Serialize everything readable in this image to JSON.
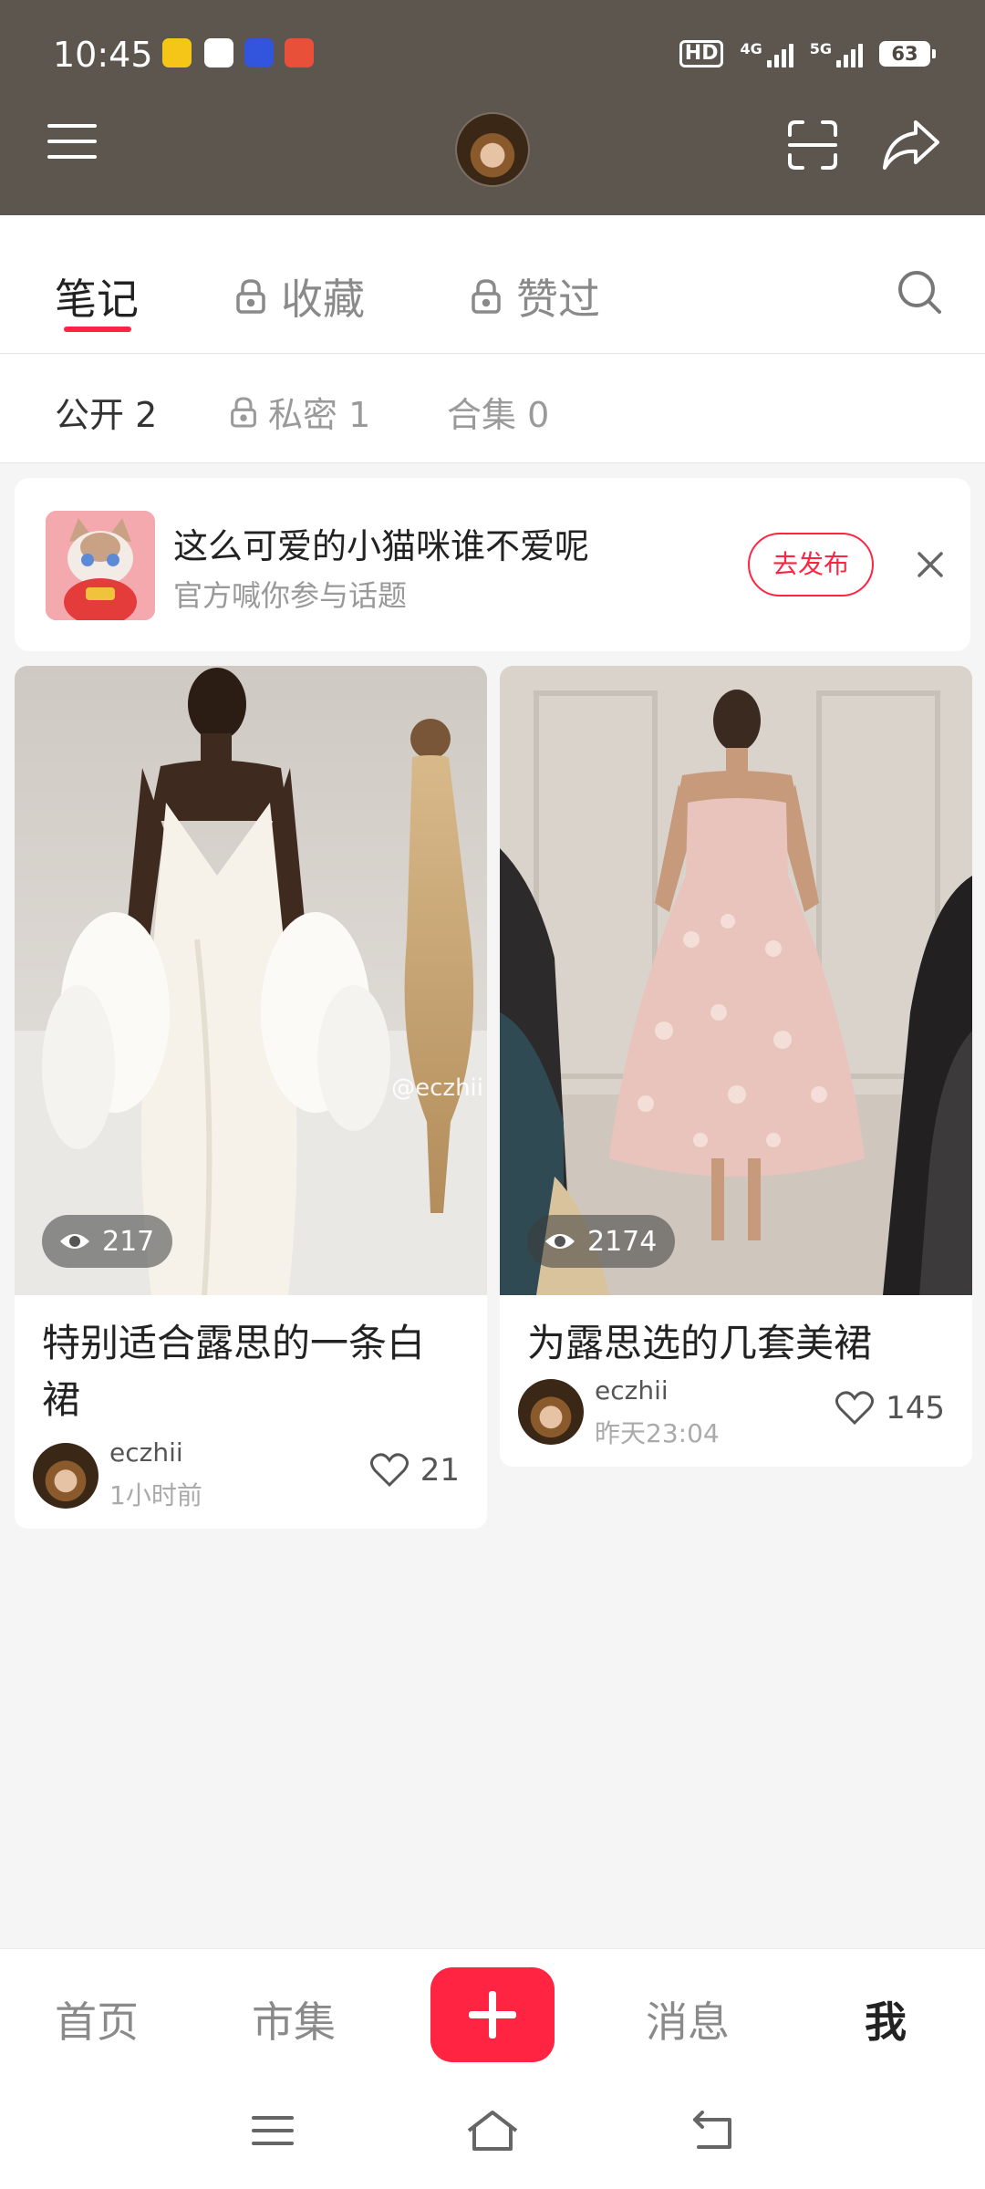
{
  "status_bar": {
    "time": "10:45",
    "app_icons": [
      {
        "name": "weibo-app-icon",
        "color": "#f5c518"
      },
      {
        "name": "wallet-app-icon",
        "color": "#ffffff"
      },
      {
        "name": "blue-app-icon",
        "color": "#3355dd"
      },
      {
        "name": "red-app-icon",
        "color": "#e8503a"
      }
    ],
    "hd_label": "HD",
    "network_1": "4G",
    "network_2": "5G",
    "battery": "63"
  },
  "tabs": {
    "notes": "笔记",
    "collections": "收藏",
    "liked": "赞过"
  },
  "subtabs": {
    "public": "公开 2",
    "private": "私密 1",
    "albums": "合集 0"
  },
  "banner": {
    "title": "这么可爱的小猫咪谁不爱呢",
    "subtitle": "官方喊你参与话题",
    "button": "去发布"
  },
  "cards": [
    {
      "views": "217",
      "watermark": "@eczhii",
      "title": "特别适合露思的一条白裙",
      "author": "eczhii",
      "time": "1小时前",
      "likes": "21"
    },
    {
      "views": "2174",
      "title": "为露思选的几套美裙",
      "author": "eczhii",
      "time": "昨天23:04",
      "likes": "145"
    }
  ],
  "bottom_nav": {
    "home": "首页",
    "market": "市集",
    "messages": "消息",
    "me": "我"
  },
  "colors": {
    "accent": "#ff2442",
    "header_bg": "#5c564f"
  }
}
